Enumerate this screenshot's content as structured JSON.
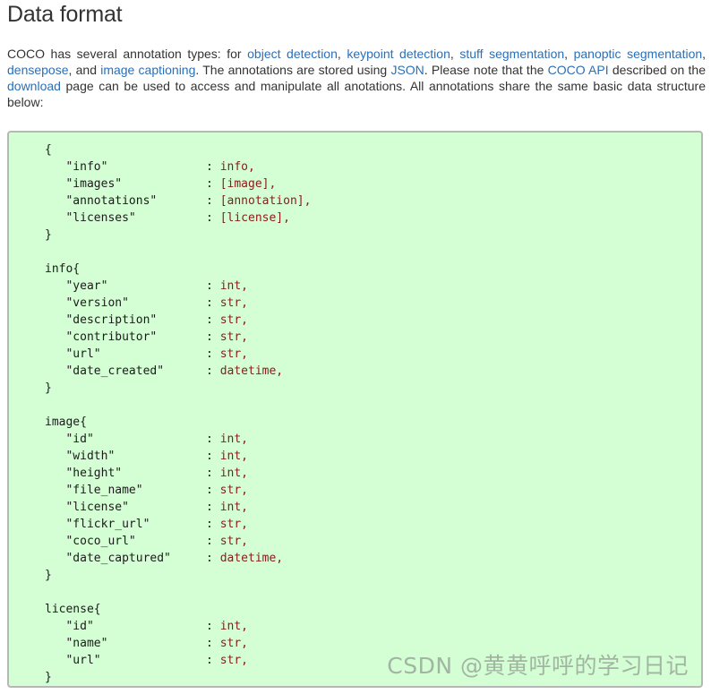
{
  "heading": "Data format",
  "intro": {
    "t1": "COCO has several annotation types: for ",
    "link_object_detection": "object detection",
    "t2": ", ",
    "link_keypoint_detection": "keypoint detection",
    "t3": ", ",
    "link_stuff_segmentation": "stuff segmentation",
    "t4": ", ",
    "link_panoptic_segmentation": "panoptic segmentation",
    "t5": ", ",
    "link_densepose": "densepose",
    "t6": ", and ",
    "link_image_captioning": "image captioning",
    "t7": ". The annotations are stored using ",
    "link_json": "JSON",
    "t8": ". Please note that the ",
    "link_coco_api": "COCO API",
    "t9": " described on the ",
    "link_download": "download",
    "t10": " page can be used to access and manipulate all anotations. All annotations share the same basic data structure below:"
  },
  "code_blocks": [
    {
      "open": "{",
      "close": "}",
      "fields": [
        {
          "key": "\"info\"",
          "value": "info,"
        },
        {
          "key": "\"images\"",
          "value": "[image],"
        },
        {
          "key": "\"annotations\"",
          "value": "[annotation],"
        },
        {
          "key": "\"licenses\"",
          "value": "[license],"
        }
      ]
    },
    {
      "open": "info{",
      "close": "}",
      "fields": [
        {
          "key": "\"year\"",
          "value": "int,"
        },
        {
          "key": "\"version\"",
          "value": "str,"
        },
        {
          "key": "\"description\"",
          "value": "str,"
        },
        {
          "key": "\"contributor\"",
          "value": "str,"
        },
        {
          "key": "\"url\"",
          "value": "str,"
        },
        {
          "key": "\"date_created\"",
          "value": "datetime,"
        }
      ]
    },
    {
      "open": "image{",
      "close": "}",
      "fields": [
        {
          "key": "\"id\"",
          "value": "int,"
        },
        {
          "key": "\"width\"",
          "value": "int,"
        },
        {
          "key": "\"height\"",
          "value": "int,"
        },
        {
          "key": "\"file_name\"",
          "value": "str,"
        },
        {
          "key": "\"license\"",
          "value": "int,"
        },
        {
          "key": "\"flickr_url\"",
          "value": "str,"
        },
        {
          "key": "\"coco_url\"",
          "value": "str,"
        },
        {
          "key": "\"date_captured\"",
          "value": "datetime,"
        }
      ]
    },
    {
      "open": "license{",
      "close": "}",
      "fields": [
        {
          "key": "\"id\"",
          "value": "int,"
        },
        {
          "key": "\"name\"",
          "value": "str,"
        },
        {
          "key": "\"url\"",
          "value": "str,"
        }
      ]
    }
  ],
  "watermark": "CSDN @黄黄呼呼的学习日记",
  "colors": {
    "link": "#2a6fb8",
    "code_background": "#d4fed4",
    "code_value": "#8b1a1a"
  }
}
